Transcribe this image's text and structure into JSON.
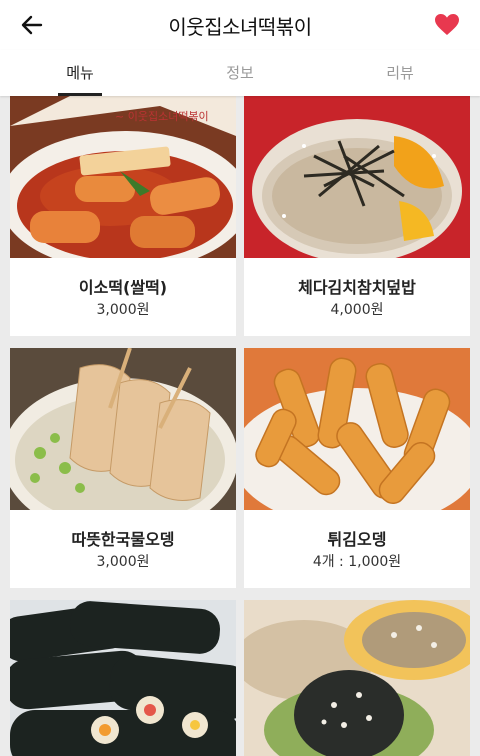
{
  "header": {
    "title": "이웃집소녀떡볶이",
    "back_icon": "arrow-left-icon",
    "favorite_icon": "heart-icon",
    "favorite_color": "#e8384f"
  },
  "tabs": [
    {
      "label": "메뉴",
      "active": true
    },
    {
      "label": "정보",
      "active": false
    },
    {
      "label": "리뷰",
      "active": false
    }
  ],
  "menu": [
    {
      "name": "이소떡(쌀떡)",
      "price": "3,000원"
    },
    {
      "name": "체다김치참치덮밥",
      "price": "4,000원"
    },
    {
      "name": "따뜻한국물오뎅",
      "price": "3,000원"
    },
    {
      "name": "튀김오뎅",
      "price": "4개 : 1,000원"
    },
    {
      "name": "",
      "price": ""
    },
    {
      "name": "",
      "price": ""
    }
  ]
}
